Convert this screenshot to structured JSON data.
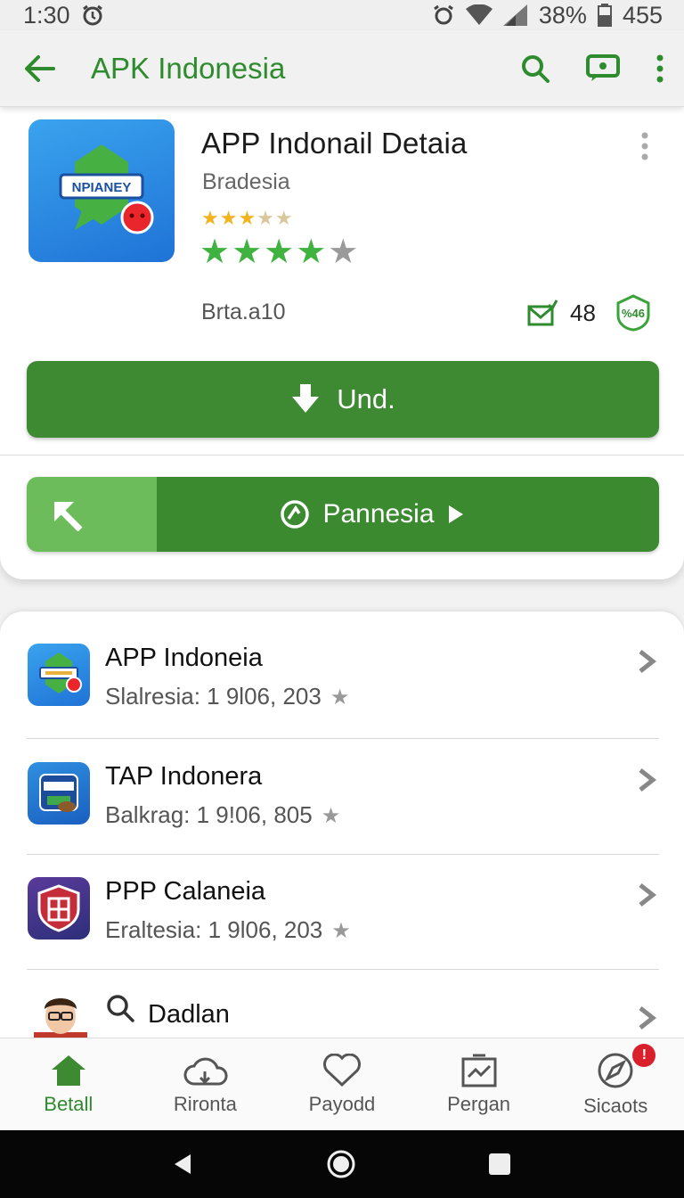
{
  "status_bar": {
    "time": "1:30",
    "battery_percent": "38%",
    "extra": "455"
  },
  "app_bar": {
    "title": "APK Indonesia",
    "icons": [
      "back-arrow-icon",
      "search-icon",
      "cast-icon",
      "more-vert-icon"
    ]
  },
  "detail": {
    "title": "APP Indonail Detaia",
    "developer": "Bradesia",
    "icon_text": "NPIANEY",
    "small_rating_stars": 3,
    "big_rating_stars": 4,
    "meta_left": "Brta.a10",
    "meta_count": "48",
    "meta_badge": "%46",
    "install_label": "Und.",
    "open_label": "Pannesia"
  },
  "list": {
    "items": [
      {
        "title": "APP Indoneia",
        "subtitle": "Slalresia: 1 9l06, 203"
      },
      {
        "title": "TAP Indonera",
        "subtitle": "Balkrag: 1 9!06, 805"
      },
      {
        "title": "PPP Calaneia",
        "subtitle": "Eraltesia: 1 9l06, 203"
      },
      {
        "title": "Dadlan",
        "subtitle": ""
      }
    ]
  },
  "bottom_nav": {
    "items": [
      {
        "label": "Betall",
        "icon": "home-icon",
        "active": true
      },
      {
        "label": "Rironta",
        "icon": "cloud-icon"
      },
      {
        "label": "Payodd",
        "icon": "heart-icon"
      },
      {
        "label": "Pergan",
        "icon": "chart-icon"
      },
      {
        "label": "Sicaots",
        "icon": "compass-icon",
        "badge": "!"
      }
    ]
  },
  "colors": {
    "accent_green": "#3d8a32",
    "title_green": "#2e8b2e",
    "star_green": "#3fb23f",
    "star_gold": "#f2b31d"
  }
}
